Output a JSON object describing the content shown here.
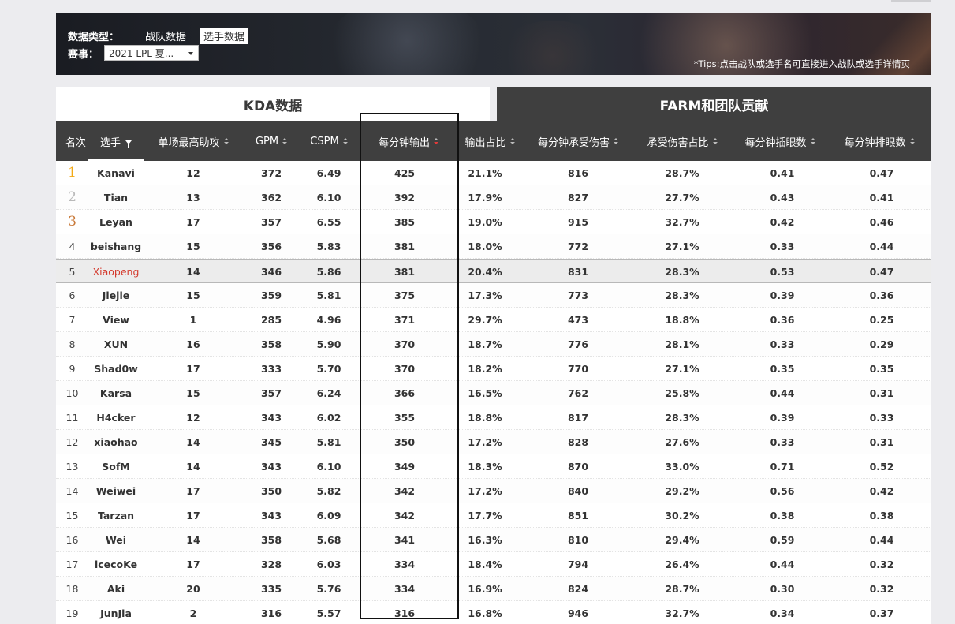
{
  "filters": {
    "data_type_label": "数据类型：",
    "options": [
      "战队数据",
      "选手数据"
    ],
    "active_option": "选手数据",
    "event_label": "赛事：",
    "event_value": "2021 LPL 夏...",
    "tips": "*Tips:点击战队或选手名可直接进入战队或选手详情页"
  },
  "tabs": {
    "kda": "KDA数据",
    "farm": "FARM和团队贡献"
  },
  "columns": [
    "名次",
    "选手",
    "单场最高助攻",
    "GPM",
    "CSPM",
    "每分钟输出",
    "输出占比",
    "每分钟承受伤害",
    "承受伤害占比",
    "每分钟插眼数",
    "每分钟排眼数"
  ],
  "rank_colors": [
    "#f3a914",
    "#b9b9b9",
    "#c97a3a"
  ],
  "rows": [
    {
      "rank": "1",
      "player": "Kanavi",
      "max_assist": "12",
      "gpm": "372",
      "cspm": "6.49",
      "dpm": "425",
      "dmg_share": "21.1%",
      "dtpm": "816",
      "dt_share": "28.7%",
      "wpm": "0.41",
      "wcpm": "0.47"
    },
    {
      "rank": "2",
      "player": "Tian",
      "max_assist": "13",
      "gpm": "362",
      "cspm": "6.10",
      "dpm": "392",
      "dmg_share": "17.9%",
      "dtpm": "827",
      "dt_share": "27.7%",
      "wpm": "0.43",
      "wcpm": "0.41"
    },
    {
      "rank": "3",
      "player": "Leyan",
      "max_assist": "17",
      "gpm": "357",
      "cspm": "6.55",
      "dpm": "385",
      "dmg_share": "19.0%",
      "dtpm": "915",
      "dt_share": "32.7%",
      "wpm": "0.42",
      "wcpm": "0.46"
    },
    {
      "rank": "4",
      "player": "beishang",
      "max_assist": "15",
      "gpm": "356",
      "cspm": "5.83",
      "dpm": "381",
      "dmg_share": "18.0%",
      "dtpm": "772",
      "dt_share": "27.1%",
      "wpm": "0.33",
      "wcpm": "0.44"
    },
    {
      "rank": "5",
      "player": "Xiaopeng",
      "max_assist": "14",
      "gpm": "346",
      "cspm": "5.86",
      "dpm": "381",
      "dmg_share": "20.4%",
      "dtpm": "831",
      "dt_share": "28.3%",
      "wpm": "0.53",
      "wcpm": "0.47"
    },
    {
      "rank": "6",
      "player": "Jiejie",
      "max_assist": "15",
      "gpm": "359",
      "cspm": "5.81",
      "dpm": "375",
      "dmg_share": "17.3%",
      "dtpm": "773",
      "dt_share": "28.3%",
      "wpm": "0.39",
      "wcpm": "0.36"
    },
    {
      "rank": "7",
      "player": "View",
      "max_assist": "1",
      "gpm": "285",
      "cspm": "4.96",
      "dpm": "371",
      "dmg_share": "29.7%",
      "dtpm": "473",
      "dt_share": "18.8%",
      "wpm": "0.36",
      "wcpm": "0.25"
    },
    {
      "rank": "8",
      "player": "XUN",
      "max_assist": "16",
      "gpm": "358",
      "cspm": "5.90",
      "dpm": "370",
      "dmg_share": "18.7%",
      "dtpm": "776",
      "dt_share": "28.1%",
      "wpm": "0.33",
      "wcpm": "0.29"
    },
    {
      "rank": "9",
      "player": "Shad0w",
      "max_assist": "17",
      "gpm": "333",
      "cspm": "5.70",
      "dpm": "370",
      "dmg_share": "18.2%",
      "dtpm": "770",
      "dt_share": "27.1%",
      "wpm": "0.35",
      "wcpm": "0.35"
    },
    {
      "rank": "10",
      "player": "Karsa",
      "max_assist": "15",
      "gpm": "357",
      "cspm": "6.24",
      "dpm": "366",
      "dmg_share": "16.5%",
      "dtpm": "762",
      "dt_share": "25.8%",
      "wpm": "0.44",
      "wcpm": "0.31"
    },
    {
      "rank": "11",
      "player": "H4cker",
      "max_assist": "12",
      "gpm": "343",
      "cspm": "6.02",
      "dpm": "355",
      "dmg_share": "18.8%",
      "dtpm": "817",
      "dt_share": "28.3%",
      "wpm": "0.39",
      "wcpm": "0.33"
    },
    {
      "rank": "12",
      "player": "xiaohao",
      "max_assist": "14",
      "gpm": "345",
      "cspm": "5.81",
      "dpm": "350",
      "dmg_share": "17.2%",
      "dtpm": "828",
      "dt_share": "27.6%",
      "wpm": "0.33",
      "wcpm": "0.31"
    },
    {
      "rank": "13",
      "player": "SofM",
      "max_assist": "14",
      "gpm": "343",
      "cspm": "6.10",
      "dpm": "349",
      "dmg_share": "18.3%",
      "dtpm": "870",
      "dt_share": "33.0%",
      "wpm": "0.71",
      "wcpm": "0.52"
    },
    {
      "rank": "14",
      "player": "Weiwei",
      "max_assist": "17",
      "gpm": "350",
      "cspm": "5.82",
      "dpm": "342",
      "dmg_share": "17.2%",
      "dtpm": "840",
      "dt_share": "29.2%",
      "wpm": "0.56",
      "wcpm": "0.42"
    },
    {
      "rank": "15",
      "player": "Tarzan",
      "max_assist": "17",
      "gpm": "343",
      "cspm": "6.09",
      "dpm": "342",
      "dmg_share": "17.7%",
      "dtpm": "851",
      "dt_share": "30.2%",
      "wpm": "0.38",
      "wcpm": "0.38"
    },
    {
      "rank": "16",
      "player": "Wei",
      "max_assist": "14",
      "gpm": "358",
      "cspm": "5.68",
      "dpm": "341",
      "dmg_share": "16.3%",
      "dtpm": "810",
      "dt_share": "29.4%",
      "wpm": "0.59",
      "wcpm": "0.44"
    },
    {
      "rank": "17",
      "player": "icecoKe",
      "max_assist": "17",
      "gpm": "328",
      "cspm": "6.03",
      "dpm": "334",
      "dmg_share": "18.4%",
      "dtpm": "794",
      "dt_share": "26.4%",
      "wpm": "0.44",
      "wcpm": "0.32"
    },
    {
      "rank": "18",
      "player": "Aki",
      "max_assist": "20",
      "gpm": "335",
      "cspm": "5.76",
      "dpm": "334",
      "dmg_share": "16.9%",
      "dtpm": "824",
      "dt_share": "28.7%",
      "wpm": "0.30",
      "wcpm": "0.32"
    },
    {
      "rank": "19",
      "player": "JunJia",
      "max_assist": "2",
      "gpm": "316",
      "cspm": "5.57",
      "dpm": "316",
      "dmg_share": "16.8%",
      "dtpm": "946",
      "dt_share": "32.7%",
      "wpm": "0.34",
      "wcpm": "0.37"
    }
  ],
  "highlighted_player": "Xiaopeng",
  "sorted_column": "每分钟输出"
}
